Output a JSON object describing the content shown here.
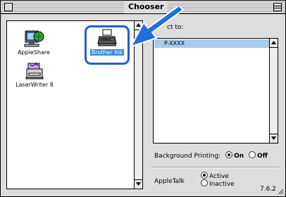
{
  "window": {
    "title": "Chooser"
  },
  "left_pane": {
    "items": [
      {
        "label": "AppleShare",
        "icon": "appleshare-icon",
        "selected": false
      },
      {
        "label": "Brother Ink",
        "icon": "printer-icon",
        "selected": true
      },
      {
        "label": "LaserWriter 8",
        "icon": "laserwriter-icon",
        "selected": false
      }
    ]
  },
  "right_pane": {
    "select_label": "ct to:",
    "printers": [
      "P-XXXX"
    ]
  },
  "background_printing": {
    "label": "Background Printing:",
    "on_label": "On",
    "off_label": "Off",
    "value": "On"
  },
  "appletalk": {
    "label": "AppleTalk",
    "active_label": "Active",
    "inactive_label": "Inactive",
    "value": "Active"
  },
  "version": "7.6.2",
  "colors": {
    "selection_ring": "#1f5fcf",
    "selection_highlight": "#3a8ad6",
    "list_highlight": "#a6cbf0",
    "arrow": "#1f6fe0"
  }
}
